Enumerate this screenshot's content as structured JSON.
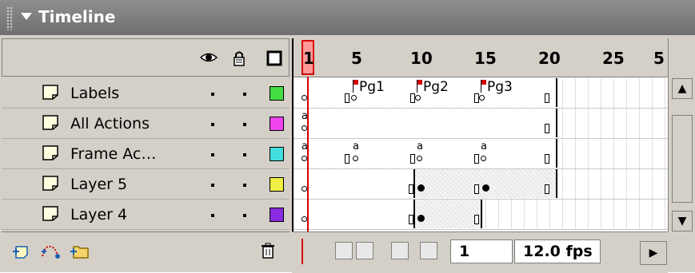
{
  "panel": {
    "title": "Timeline"
  },
  "layers": [
    {
      "name": "Labels",
      "color": "#44dd44"
    },
    {
      "name": "All Actions",
      "color": "#ee44ee"
    },
    {
      "name": "Frame Ac…",
      "color": "#44dddd"
    },
    {
      "name": "Layer 5",
      "color": "#eeee44"
    },
    {
      "name": "Layer 4",
      "color": "#8a2be2"
    }
  ],
  "header_icons": {
    "eye": "eye-icon",
    "lock": "lock-icon",
    "outline": "outline-icon"
  },
  "footer_icons": [
    "add-layer-icon",
    "add-motion-guide-icon",
    "insert-layer-folder-icon",
    "trash-icon"
  ],
  "ruler": {
    "ticks": [
      "1",
      "5",
      "10",
      "15",
      "20",
      "25",
      "5"
    ],
    "current_frame": "1"
  },
  "frame_labels": [
    "Pg1",
    "Pg2",
    "Pg3"
  ],
  "frame_alpha": "a",
  "timeline_footer": {
    "current_frame": "1",
    "fps": "12.0 fps"
  }
}
